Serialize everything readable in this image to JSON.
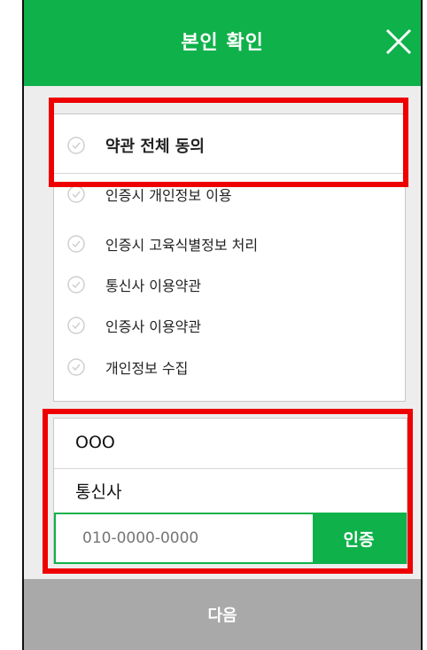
{
  "header": {
    "title": "본인 확인",
    "close_icon": "close-icon"
  },
  "terms": {
    "all_label": "약관 전체 동의",
    "items": [
      {
        "label": "인증시 개인정보 이용"
      },
      {
        "label": "인증시 고육식별정보 처리"
      },
      {
        "label": "통신사 이용약관"
      },
      {
        "label": "인증사 이용약관"
      },
      {
        "label": "개인정보 수집"
      }
    ]
  },
  "form": {
    "name": "OOO",
    "carrier": "통신사",
    "phone_placeholder": "010-0000-0000",
    "verify_label": "인증"
  },
  "footer": {
    "next_label": "다음"
  },
  "colors": {
    "accent": "#0fb14a",
    "highlight": "#ee0000",
    "disabled": "#a9a9a9"
  }
}
